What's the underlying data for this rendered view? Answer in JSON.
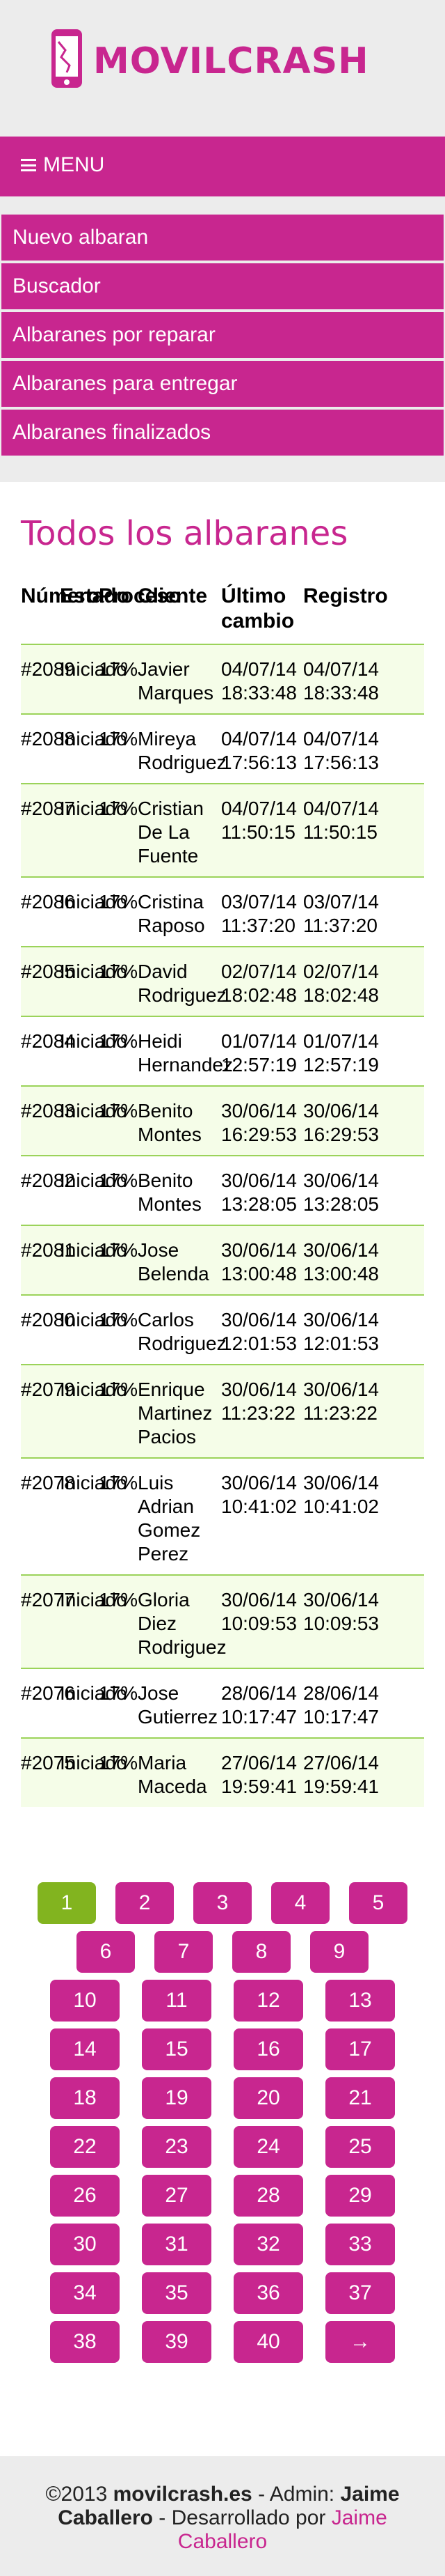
{
  "brand": {
    "name": "MOVILCRASH",
    "logo_icon": "phone-crash-icon"
  },
  "menu": {
    "label": "MENU"
  },
  "nav": [
    "Nuevo albaran",
    "Buscador",
    "Albaranes por reparar",
    "Albaranes para entregar",
    "Albaranes finalizados"
  ],
  "page_title": "Todos los albaranes",
  "table": {
    "headers": [
      "Número",
      "Estado",
      "Proceso",
      "Cliente",
      "Último cambio",
      "Registro"
    ],
    "rows": [
      [
        "#2089",
        "Iniciado",
        "17%",
        "Javier Marques",
        "04/07/14 18:33:48",
        "04/07/14 18:33:48"
      ],
      [
        "#2088",
        "Iniciado",
        "17%",
        "Mireya Rodriguez",
        "04/07/14 17:56:13",
        "04/07/14 17:56:13"
      ],
      [
        "#2087",
        "Iniciado",
        "17%",
        "Cristian De La Fuente",
        "04/07/14 11:50:15",
        "04/07/14 11:50:15"
      ],
      [
        "#2086",
        "Iniciado",
        "17%",
        "Cristina Raposo",
        "03/07/14 11:37:20",
        "03/07/14 11:37:20"
      ],
      [
        "#2085",
        "Iniciado",
        "17%",
        "David Rodriguez",
        "02/07/14 18:02:48",
        "02/07/14 18:02:48"
      ],
      [
        "#2084",
        "Iniciado",
        "17%",
        "Heidi Hernandez",
        "01/07/14 12:57:19",
        "01/07/14 12:57:19"
      ],
      [
        "#2083",
        "Iniciado",
        "17%",
        "Benito Montes",
        "30/06/14 16:29:53",
        "30/06/14 16:29:53"
      ],
      [
        "#2082",
        "Iniciado",
        "17%",
        "Benito Montes",
        "30/06/14 13:28:05",
        "30/06/14 13:28:05"
      ],
      [
        "#2081",
        "Iniciado",
        "17%",
        "Jose Belenda",
        "30/06/14 13:00:48",
        "30/06/14 13:00:48"
      ],
      [
        "#2080",
        "Iniciado",
        "17%",
        "Carlos Rodriguez",
        "30/06/14 12:01:53",
        "30/06/14 12:01:53"
      ],
      [
        "#2079",
        "Iniciado",
        "17%",
        "Enrique Martinez Pacios",
        "30/06/14 11:23:22",
        "30/06/14 11:23:22"
      ],
      [
        "#2078",
        "Iniciado",
        "17%",
        "Luis Adrian Gomez Perez",
        "30/06/14 10:41:02",
        "30/06/14 10:41:02"
      ],
      [
        "#2077",
        "Iniciado",
        "17%",
        "Gloria Diez Rodriguez",
        "30/06/14 10:09:53",
        "30/06/14 10:09:53"
      ],
      [
        "#2076",
        "Iniciado",
        "17%",
        "Jose Gutierrez",
        "28/06/14 10:17:47",
        "28/06/14 10:17:47"
      ],
      [
        "#2075",
        "Iniciado",
        "17%",
        "Maria Maceda",
        "27/06/14 19:59:41",
        "27/06/14 19:59:41"
      ]
    ]
  },
  "pagination": {
    "rows": [
      [
        "1",
        "2",
        "3",
        "4",
        "5"
      ],
      [
        "6",
        "7",
        "8",
        "9"
      ],
      [
        "10",
        "11",
        "12",
        "13"
      ],
      [
        "14",
        "15",
        "16",
        "17"
      ],
      [
        "18",
        "19",
        "20",
        "21"
      ],
      [
        "22",
        "23",
        "24",
        "25"
      ],
      [
        "26",
        "27",
        "28",
        "29"
      ],
      [
        "30",
        "31",
        "32",
        "33"
      ],
      [
        "34",
        "35",
        "36",
        "37"
      ],
      [
        "38",
        "39",
        "40",
        "→"
      ]
    ],
    "active": "1"
  },
  "footer": {
    "copyright": "©2013 ",
    "site": "movilcrash.es",
    "admin_prefix": " - Admin: ",
    "admin": "Jaime Caballero",
    "dev_prefix": " - Desarrollado por ",
    "dev": "Jaime Caballero"
  },
  "colors": {
    "brand": "#c8268f",
    "active_page": "#82b41f",
    "row_highlight": "#f5fde8",
    "row_border": "#9bd35a"
  }
}
